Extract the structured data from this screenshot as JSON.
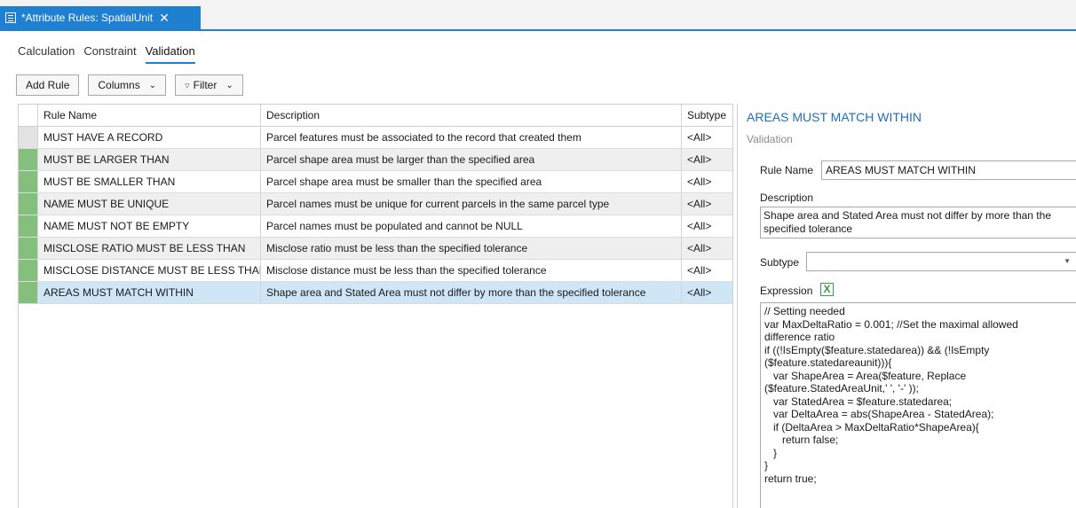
{
  "tab": {
    "title": "*Attribute Rules: SpatialUnit",
    "icon": "table-icon",
    "close": "✕"
  },
  "view_tabs": [
    "Calculation",
    "Constraint",
    "Validation"
  ],
  "toolbar": {
    "add_rule": "Add Rule",
    "columns": "Columns",
    "filter": "Filter"
  },
  "grid": {
    "headers": {
      "name": "Rule Name",
      "description": "Description",
      "subtype": "Subtype"
    },
    "rows": [
      {
        "name": "MUST HAVE A RECORD",
        "description": "Parcel features must be associated to the record that created them",
        "subtype": "<All>"
      },
      {
        "name": "MUST BE LARGER THAN",
        "description": "Parcel shape area must be larger than the specified area",
        "subtype": "<All>"
      },
      {
        "name": "MUST BE SMALLER THAN",
        "description": "Parcel shape area must be smaller than the specified area",
        "subtype": "<All>"
      },
      {
        "name": "NAME MUST BE UNIQUE",
        "description": "Parcel names must be unique for current parcels in the same parcel type",
        "subtype": "<All>"
      },
      {
        "name": "NAME MUST NOT BE EMPTY",
        "description": "Parcel names must be populated and cannot be NULL",
        "subtype": "<All>"
      },
      {
        "name": "MISCLOSE RATIO MUST BE LESS THAN",
        "description": "Misclose ratio must be less than the specified tolerance",
        "subtype": "<All>"
      },
      {
        "name": "MISCLOSE DISTANCE MUST BE LESS THAN",
        "description": "Misclose distance must be less than the specified tolerance",
        "subtype": "<All>"
      },
      {
        "name": "AREAS MUST MATCH WITHIN",
        "description": "Shape area and Stated Area must not differ by more than the specified tolerance",
        "subtype": "<All>"
      }
    ]
  },
  "details": {
    "title": "AREAS MUST MATCH WITHIN",
    "subtitle": "Validation",
    "rule_name_label": "Rule Name",
    "rule_name_value": "AREAS MUST MATCH WITHIN",
    "description_label": "Description",
    "description_value": "Shape area and Stated Area must not differ by more than the specified tolerance",
    "subtype_label": "Subtype",
    "subtype_value": "",
    "expression_label": "Expression",
    "expression_code": "// Setting needed\nvar MaxDeltaRatio = 0.001; //Set the maximal allowed\ndifference ratio\nif ((!IsEmpty($feature.statedarea)) && (!IsEmpty\n($feature.statedareaunit))){\n   var ShapeArea = Area($feature, Replace\n($feature.StatedAreaUnit,' ', '-' ));\n   var StatedArea = $feature.statedarea;\n   var DeltaArea = abs(ShapeArea - StatedArea);\n   if (DeltaArea > MaxDeltaRatio*ShapeArea){\n      return false;\n   }\n}\nreturn true;"
  }
}
